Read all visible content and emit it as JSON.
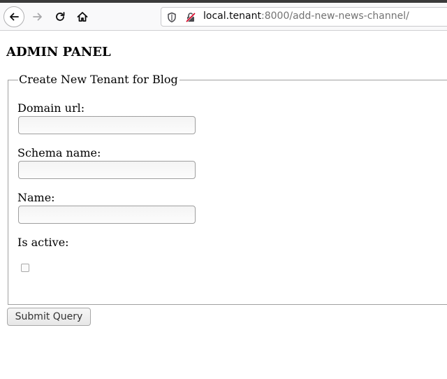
{
  "browser": {
    "url_host": "local.tenant",
    "url_rest": ":8000/add-new-news-channel/"
  },
  "page": {
    "title": "ADMIN PANEL",
    "form": {
      "legend": "Create New Tenant for Blog",
      "fields": [
        {
          "label": "Domain url:",
          "value": "",
          "type": "text"
        },
        {
          "label": "Schema name:",
          "value": "",
          "type": "text"
        },
        {
          "label": "Name:",
          "value": "",
          "type": "text"
        },
        {
          "label": "Is active:",
          "checked": false,
          "type": "checkbox"
        }
      ],
      "submit_label": "Submit Query"
    }
  },
  "icons": {
    "back": "back-arrow-icon",
    "forward": "forward-arrow-icon",
    "reload": "reload-icon",
    "home": "home-icon",
    "shield": "shield-icon",
    "insecure": "insecure-connection-icon"
  }
}
